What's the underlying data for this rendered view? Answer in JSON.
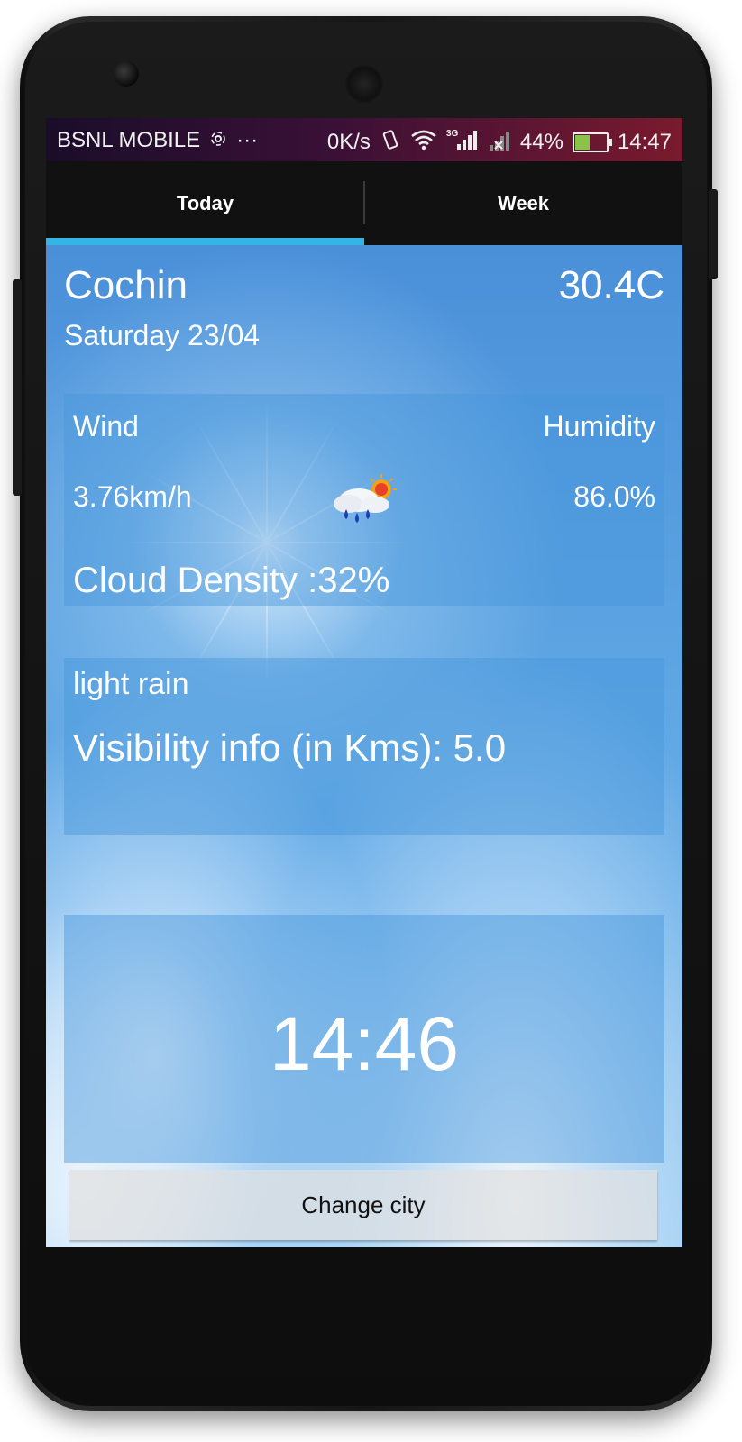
{
  "status_bar": {
    "carrier": "BSNL MOBILE",
    "dots": "···",
    "speed": "0K/s",
    "network": "3G",
    "battery": "44%",
    "battery_level": 0.44,
    "time": "14:47"
  },
  "tabs": [
    {
      "label": "Today",
      "selected": true
    },
    {
      "label": "Week",
      "selected": false
    }
  ],
  "weather": {
    "city": "Cochin",
    "temperature": "30.4C",
    "date": "Saturday 23/04",
    "wind_label": "Wind",
    "wind_value": "3.76km/h",
    "humidity_label": "Humidity",
    "humidity_value": "86.0%",
    "cloud_density": "Cloud Density :32%",
    "icon": "rain-sun-cloud-icon",
    "description": "light rain",
    "visibility": "Visibility info (in Kms): 5.0",
    "clock": "14:46"
  },
  "actions": {
    "change_city": "Change city"
  },
  "colors": {
    "tab_indicator": "#33b5e5",
    "tab_bar": "#111111",
    "sky": "#5fa6e3"
  }
}
